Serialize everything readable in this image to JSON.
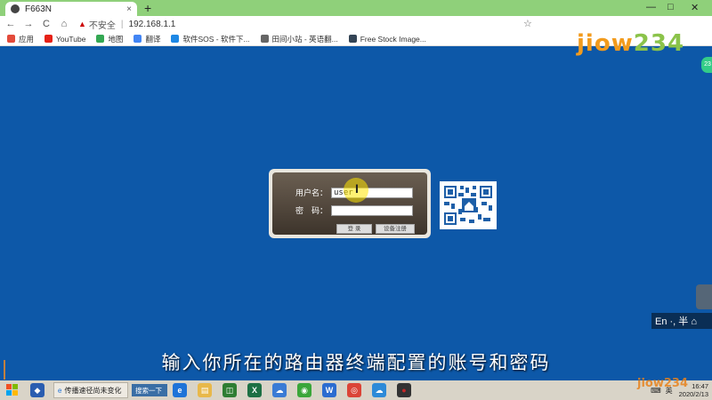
{
  "browser": {
    "tab_title": "F663N",
    "tab_close": "×",
    "new_tab": "+",
    "window_controls": [
      "—",
      "□",
      "✕"
    ],
    "nav": {
      "back": "←",
      "forward": "→",
      "reload": "C",
      "home": "⌂"
    },
    "address": {
      "warning_icon": "▲",
      "insecure_label": "不安全",
      "separator": "|",
      "url": "192.168.1.1"
    },
    "star": "☆",
    "bookmarks": [
      {
        "label": "应用",
        "icon_color": "#e34b3b"
      },
      {
        "label": "YouTube",
        "icon_color": "#e62117"
      },
      {
        "label": "地图",
        "icon_color": "#34a853"
      },
      {
        "label": "翻译",
        "icon_color": "#4285f4"
      },
      {
        "label": "软件SOS - 软件下...",
        "icon_color": "#1e88e5"
      },
      {
        "label": "田间小站 - 英语翻...",
        "icon_color": "#666666"
      },
      {
        "label": "Free Stock Image...",
        "icon_color": "#334455"
      }
    ]
  },
  "logo": {
    "text": [
      "j",
      "i",
      "o",
      "w",
      "2",
      "3",
      "4"
    ],
    "colors": [
      "#f29b1d",
      "#f29b1d",
      "#f29b1d",
      "#f29b1d",
      "#8bc34a",
      "#8bc34a",
      "#8bc34a"
    ]
  },
  "login": {
    "username_label": "用户名：",
    "username_value": "user",
    "password_label": "密　码：",
    "password_value": "",
    "login_button": "登 录",
    "second_button": "设备注册"
  },
  "side": {
    "bubble_text": "23",
    "ime_text": "En ·, 半 ⌂"
  },
  "subtitle": "输入你所在的路由器终端配置的账号和密码",
  "taskbar": {
    "task_label": "传播速径尚未变化",
    "search_label": "搜索一下",
    "apps": [
      {
        "name": "ie-icon",
        "glyph": "e",
        "color": "#1e73d8"
      },
      {
        "name": "file-explorer-icon",
        "glyph": "▤",
        "color": "#e8b84a"
      },
      {
        "name": "store-icon",
        "glyph": "◫",
        "color": "#2e7d32"
      },
      {
        "name": "excel-icon",
        "glyph": "X",
        "color": "#1d7044"
      },
      {
        "name": "baidu-netdisk-icon",
        "glyph": "☁",
        "color": "#3a7bd5"
      },
      {
        "name": "360-browser-icon",
        "glyph": "◉",
        "color": "#3aa63a"
      },
      {
        "name": "wps-icon",
        "glyph": "W",
        "color": "#2b6cd0"
      },
      {
        "name": "chrome-icon",
        "glyph": "◎",
        "color": "#db4437"
      },
      {
        "name": "cloud-icon",
        "glyph": "☁",
        "color": "#2d8ad8"
      },
      {
        "name": "record-icon",
        "glyph": "●",
        "color": "#c62828"
      }
    ],
    "tray": {
      "keyboard": "⌨",
      "lang": "英",
      "time": "16:47",
      "date": "2020/2/13"
    }
  },
  "watermark": "jiow234"
}
